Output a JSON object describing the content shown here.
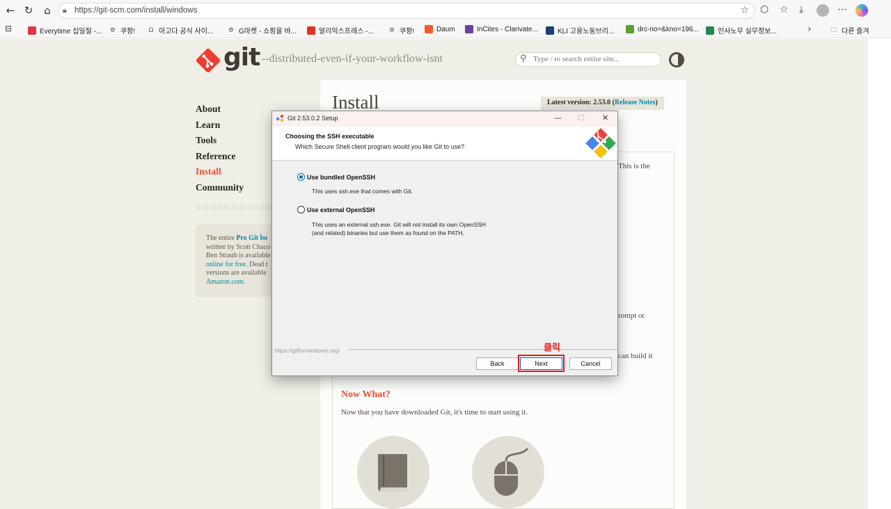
{
  "browser": {
    "url": "https://git-scm.com/install/windows",
    "bookmarks": [
      {
        "label": "Everytime 십일절 -...",
        "icon": "everytime-icon",
        "color": "#e8323c"
      },
      {
        "label": "쿠팡!",
        "icon": "globe-icon",
        "color": "#555555"
      },
      {
        "label": "아고다 공식 사이...",
        "icon": "agoda-icon",
        "color": "#555555"
      },
      {
        "label": "G마켓 - 쇼핑을 바...",
        "icon": "globe-icon",
        "color": "#555555"
      },
      {
        "label": "알리익스프레스 -...",
        "icon": "aliexpress-icon",
        "color": "#e43225"
      },
      {
        "label": "쿠팡!",
        "icon": "globe-icon",
        "color": "#555555"
      },
      {
        "label": "Daum",
        "icon": "daum-icon",
        "color": "#f25c2b"
      },
      {
        "label": "InCites - Clarivate...",
        "icon": "incites-icon",
        "color": "#6b3fa0"
      },
      {
        "label": "KLI 고용노동브리...",
        "icon": "kli-icon",
        "color": "#1e3f7a"
      },
      {
        "label": "drc-no=&kno=196...",
        "icon": "drc-icon",
        "color": "#5aa02c"
      },
      {
        "label": "인사노무 실무정보...",
        "icon": "sheet-icon",
        "color": "#1f8a4c"
      },
      {
        "label": "다른 즐겨",
        "icon": "folder-icon",
        "color": "#555555"
      }
    ]
  },
  "site": {
    "logo_text": "git",
    "tagline": "--distributed-even-if-your-workflow-isnt",
    "search_placeholder": "Type / to search entire site...",
    "nav": [
      "About",
      "Learn",
      "Tools",
      "Reference",
      "Install",
      "Community"
    ],
    "active_nav": "Install",
    "book": {
      "line1_pre": "The entire ",
      "line1_link": "Pro Git bo",
      "line2": "written by Scott Chaco",
      "line3": "Ben Straub is available",
      "line4_link": "online for free.",
      "line4_post": " Dead t",
      "line5": "versions are available",
      "line6_link": "Amazon.com",
      "line6_post": "."
    },
    "install_title": "Install",
    "latest_version_prefix": "Latest version: 2.53.0 (",
    "release_notes": "Release Notes",
    "latest_version_suffix": ")",
    "fragments": {
      "this_is_the": "This is the",
      "prompt_or": "rompt or",
      "can_build_it": "can build it"
    },
    "now_what_title": "Now What?",
    "now_what_text": "Now that you have downloaded Git, it's time to start using it."
  },
  "dialog": {
    "title": "Git 2.53.0.2 Setup",
    "header_title": "Choosing the SSH executable",
    "header_subtitle": "Which Secure Shell client program would you like Git to use?",
    "options": [
      {
        "label": "Use bundled OpenSSH",
        "desc": [
          "This uses ssh.exe that comes with Git."
        ],
        "selected": true
      },
      {
        "label": "Use external OpenSSH",
        "desc": [
          "This uses an external ssh.exe. Git will not install its own OpenSSH",
          "(and related) binaries but use them as found on the PATH."
        ],
        "selected": false
      }
    ],
    "footer_url": "https://gitforwindows.org/",
    "buttons": {
      "back": "Back",
      "next": "Next",
      "cancel": "Cancel"
    }
  },
  "annotation": {
    "label": "클릭",
    "color": "#e61a1a"
  }
}
